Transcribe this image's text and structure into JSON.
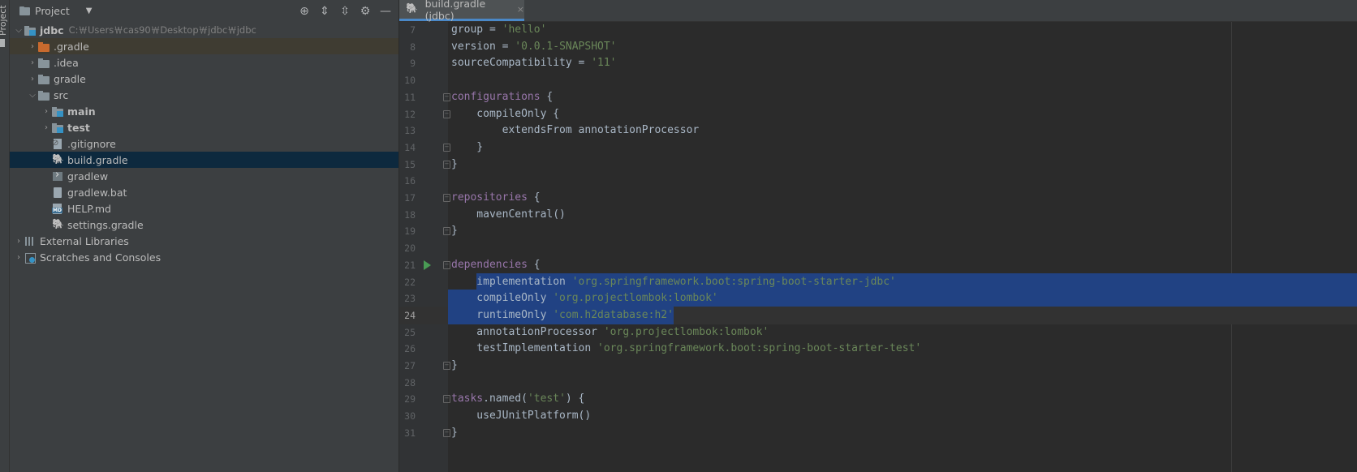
{
  "side_strip": {
    "label": "Project"
  },
  "project_panel": {
    "title": "Project",
    "tools": [
      {
        "name": "locate-icon",
        "glyph": "⊕"
      },
      {
        "name": "expand-all-icon",
        "glyph": "⇕"
      },
      {
        "name": "collapse-all-icon",
        "glyph": "⇳"
      },
      {
        "name": "gear-icon",
        "glyph": "⚙"
      },
      {
        "name": "minimize-icon",
        "glyph": "—"
      }
    ],
    "tree": [
      {
        "label": "jdbc",
        "path": "C:￦Users￦cas90￦Desktop￦jdbc￦jdbc",
        "icon": "folder-blue",
        "indent": 0,
        "arrow": "⌵",
        "bold": true
      },
      {
        "label": ".gradle",
        "icon": "folder-orange",
        "indent": 1,
        "arrow": "›",
        "highlight": true
      },
      {
        "label": ".idea",
        "icon": "folder",
        "indent": 1,
        "arrow": "›"
      },
      {
        "label": "gradle",
        "icon": "folder",
        "indent": 1,
        "arrow": "›"
      },
      {
        "label": "src",
        "icon": "folder",
        "indent": 1,
        "arrow": "⌵"
      },
      {
        "label": "main",
        "icon": "folder-blue",
        "indent": 2,
        "arrow": "›",
        "bold": true
      },
      {
        "label": "test",
        "icon": "folder-blue",
        "indent": 2,
        "arrow": "›",
        "bold": true
      },
      {
        "label": ".gitignore",
        "icon": "git",
        "indent": 2,
        "arrow": ""
      },
      {
        "label": "build.gradle",
        "icon": "gradle",
        "indent": 2,
        "arrow": "",
        "selected": true
      },
      {
        "label": "gradlew",
        "icon": "term",
        "indent": 2,
        "arrow": ""
      },
      {
        "label": "gradlew.bat",
        "icon": "file",
        "indent": 2,
        "arrow": ""
      },
      {
        "label": "HELP.md",
        "icon": "md",
        "indent": 2,
        "arrow": ""
      },
      {
        "label": "settings.gradle",
        "icon": "gradle",
        "indent": 2,
        "arrow": ""
      },
      {
        "label": "External Libraries",
        "icon": "lib",
        "indent": 0,
        "arrow": "›"
      },
      {
        "label": "Scratches and Consoles",
        "icon": "scratch",
        "indent": 0,
        "arrow": "›"
      }
    ]
  },
  "editor_tab": {
    "label": "build.gradle (jdbc)",
    "close": "×"
  },
  "editor": {
    "current_line": 24,
    "lines": [
      {
        "n": "7",
        "tokens": [
          [
            "plain",
            "group = "
          ],
          [
            "str",
            "'hello'"
          ]
        ]
      },
      {
        "n": "8",
        "tokens": [
          [
            "plain",
            "version = "
          ],
          [
            "str",
            "'0.0.1-SNAPSHOT'"
          ]
        ]
      },
      {
        "n": "9",
        "tokens": [
          [
            "plain",
            "sourceCompatibility = "
          ],
          [
            "str",
            "'11'"
          ]
        ]
      },
      {
        "n": "10",
        "tokens": []
      },
      {
        "n": "11",
        "tokens": [
          [
            "fn",
            "configurations"
          ],
          [
            "plain",
            " {"
          ]
        ],
        "fold": true
      },
      {
        "n": "12",
        "tokens": [
          [
            "plain",
            "    compileOnly {"
          ]
        ],
        "fold": true
      },
      {
        "n": "13",
        "tokens": [
          [
            "plain",
            "        extendsFrom annotationProcessor"
          ]
        ]
      },
      {
        "n": "14",
        "tokens": [
          [
            "plain",
            "    }"
          ]
        ],
        "fold": true
      },
      {
        "n": "15",
        "tokens": [
          [
            "plain",
            "}"
          ]
        ],
        "fold": true
      },
      {
        "n": "16",
        "tokens": []
      },
      {
        "n": "17",
        "tokens": [
          [
            "fn",
            "repositories"
          ],
          [
            "plain",
            " {"
          ]
        ],
        "fold": true
      },
      {
        "n": "18",
        "tokens": [
          [
            "plain",
            "    mavenCentral()"
          ]
        ]
      },
      {
        "n": "19",
        "tokens": [
          [
            "plain",
            "}"
          ]
        ],
        "fold": true
      },
      {
        "n": "20",
        "tokens": []
      },
      {
        "n": "21",
        "tokens": [
          [
            "fn",
            "dependencies"
          ],
          [
            "plain",
            " {"
          ]
        ],
        "fold": true,
        "run": true
      },
      {
        "n": "22",
        "tokens": [
          [
            "plain",
            "    implementation "
          ],
          [
            "str",
            "'org.springframework.boot:spring-boot-starter-jdbc'"
          ]
        ],
        "sel": "partial-start"
      },
      {
        "n": "23",
        "tokens": [
          [
            "plain",
            "    compileOnly "
          ],
          [
            "str",
            "'org.projectlombok:lombok'"
          ]
        ],
        "sel": "full"
      },
      {
        "n": "24",
        "tokens": [
          [
            "plain",
            "    runtimeOnly "
          ],
          [
            "str",
            "'com.h2database:h2'"
          ]
        ],
        "sel": "partial-end"
      },
      {
        "n": "25",
        "tokens": [
          [
            "plain",
            "    annotationProcessor "
          ],
          [
            "str",
            "'org.projectlombok:lombok'"
          ]
        ]
      },
      {
        "n": "26",
        "tokens": [
          [
            "plain",
            "    testImplementation "
          ],
          [
            "str",
            "'org.springframework.boot:spring-boot-starter-test'"
          ]
        ]
      },
      {
        "n": "27",
        "tokens": [
          [
            "plain",
            "}"
          ]
        ],
        "fold": true
      },
      {
        "n": "28",
        "tokens": []
      },
      {
        "n": "29",
        "tokens": [
          [
            "fn",
            "tasks"
          ],
          [
            "plain",
            ".named("
          ],
          [
            "str",
            "'test'"
          ],
          [
            "plain",
            ") {"
          ]
        ],
        "fold": true
      },
      {
        "n": "30",
        "tokens": [
          [
            "plain",
            "    useJUnitPlatform()"
          ]
        ]
      },
      {
        "n": "31",
        "tokens": [
          [
            "plain",
            "}"
          ]
        ],
        "fold": true
      }
    ]
  }
}
